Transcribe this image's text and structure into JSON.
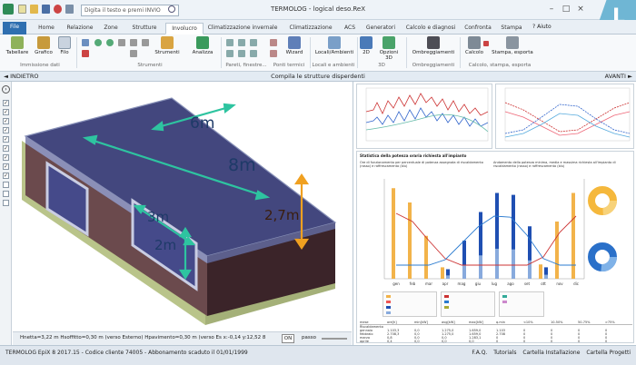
{
  "app": {
    "title": "TERMOLOG - logical deso.ReX",
    "search_placeholder": "Digita il testo e premi INVIO",
    "corner_logo": "L"
  },
  "tabs": [
    "File",
    "Home",
    "Relazione",
    "Zone",
    "Strutture",
    "Involucro",
    "Climatizzazione invernale",
    "Climatizzazione estiva",
    "ACS",
    "Generatori",
    "Calcolo e diagnosi",
    "Confronta",
    "Stampa"
  ],
  "active_tab": "Involucro",
  "help_label": "? Aiuto",
  "ribbon": {
    "buttons": {
      "tabellare": "Tabellare",
      "grafico": "Grafico",
      "filo": "Filo",
      "strumenti": "Strumenti",
      "analizza": "Analizza",
      "wizard": "Wizard",
      "locali": "Locali/Ambienti",
      "btn2d": "2D",
      "opzioni3d": "Opzioni 3D",
      "ombreggiamenti": "Ombreggiamenti",
      "calcolo": "Calcolo",
      "stampa_esporta": "Stampa, esporta"
    },
    "groups": {
      "immissione": "Immissione dati",
      "strumenti": "Strumenti",
      "pareti": "Pareti, finestre...",
      "ponti": "Ponti termici",
      "locali": "Locali e ambienti",
      "g3d": "3D",
      "ombre": "Ombreggiamenti",
      "calcolo": "Calcolo, stampa, esporta"
    }
  },
  "navbar": {
    "back": "◄ INDIETRO",
    "caption": "Compila le strutture disperdenti",
    "forward": "AVANTI ►"
  },
  "view": {
    "labels": {
      "d6": "6m",
      "d8": "8m",
      "d27": "2,7m",
      "d3": "3m",
      "d2": "2m"
    },
    "colors": {
      "roof": "#43477e",
      "wall": "#6b4a4d",
      "wall_dark": "#3b2429",
      "arrow_green": "#2ec4a0",
      "arrow_orange": "#f0a020",
      "ground": "#b9c48a"
    },
    "status_coords": "Hnetta=3,22 m  Hsoffitto=0,30 m (verso Esterno)  Hpavimento=0,30 m (verso Es x:-0,14   y:12,52 8",
    "on_label": "ON",
    "passo_label": "passo"
  },
  "stats": {
    "panel_title": "Statistica della potenza oraria richiesta all'impianto",
    "legend_left": "Ore di funzionamento per percentuale di potenza assegnata di riscaldamento (rosso) e raffrescamento (blu)",
    "legend_right": "Andamento della potenza minima, media e massima richiesta all'impianto di riscaldamento (rosso) e raffrescamento (blu)",
    "months": [
      "gen",
      "feb",
      "mar",
      "apr",
      "mag",
      "giu",
      "lug",
      "ago",
      "set",
      "ott",
      "nov",
      "dic"
    ],
    "table_header": [
      "mese",
      "ore[h]",
      "min[kW]",
      "avg[kW]",
      "max[kW]",
      "q.min",
      "<10%",
      "10-50%",
      "50-75%",
      ">75%"
    ],
    "table_rows": [
      [
        "Riscaldamento",
        "",
        "",
        "",
        "",
        "",
        "",
        "",
        "",
        ""
      ],
      [
        "gennaio",
        "1.103,3",
        "0,0",
        "1.275,0",
        "1.659,0",
        "1.103",
        "0",
        "0",
        "0",
        "0"
      ],
      [
        "febbraio",
        "2.708,3",
        "0,0",
        "1.275,0",
        "1.659,0",
        "2.708",
        "0",
        "0",
        "0",
        "0"
      ],
      [
        "marzo",
        "0,8",
        "0,0",
        "0,0",
        "1.283,1",
        "0",
        "0",
        "0",
        "0",
        "0"
      ],
      [
        "aprile",
        "0,4",
        "0,0",
        "0,0",
        "0,0",
        "0",
        "0",
        "0",
        "0",
        "0"
      ]
    ],
    "pie_top": {
      "label": "",
      "values": [
        12,
        30,
        40,
        18
      ]
    },
    "pie_bottom": {
      "label": "",
      "values": [
        15,
        35,
        30,
        20
      ]
    }
  },
  "statusbar": {
    "license": "TERMOLOG EpiX 8 2017.15 - Codice cliente 74005 - Abbonamento scaduto il 01/01/1999",
    "links": [
      "F.A.Q.",
      "Tutorials",
      "Cartella Installazione",
      "Cartella Progetti"
    ]
  }
}
